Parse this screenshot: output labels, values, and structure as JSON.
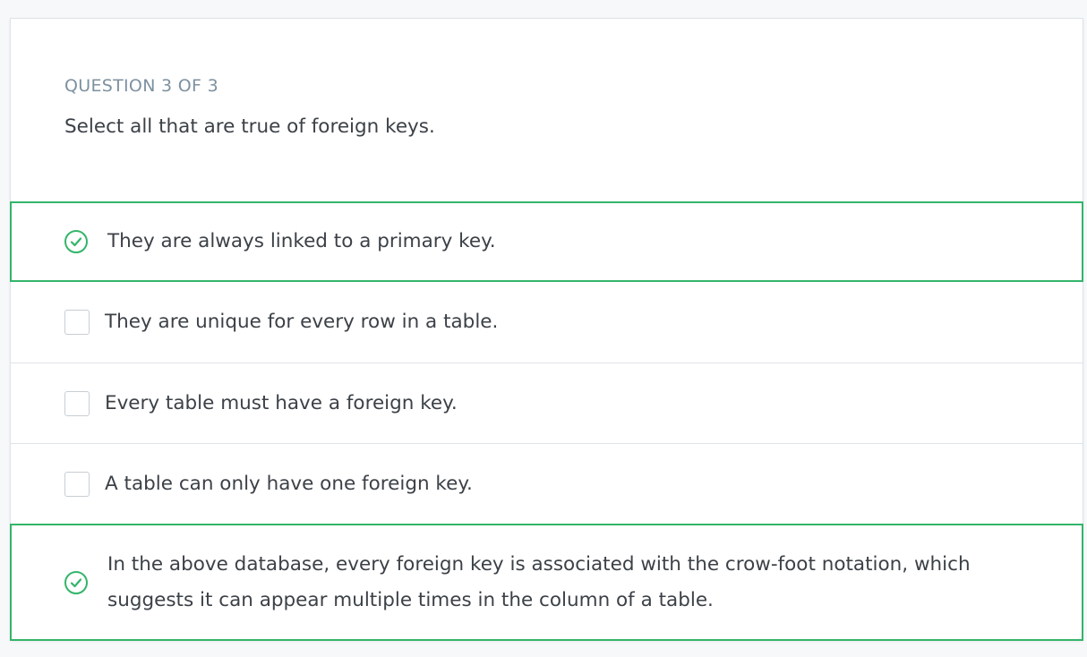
{
  "question": {
    "counter": "QUESTION 3 OF 3",
    "prompt": "Select all that are true of foreign keys."
  },
  "options": [
    {
      "label": "They are always linked to a primary key.",
      "state": "correct"
    },
    {
      "label": "They are unique for every row in a table.",
      "state": "unchecked"
    },
    {
      "label": "Every table must have a foreign key.",
      "state": "unchecked"
    },
    {
      "label": "A table can only have one foreign key.",
      "state": "unchecked"
    },
    {
      "label": "In the above database, every foreign key is associated with the crow-foot notation, which suggests it can appear multiple times in the column of a table.",
      "state": "correct"
    }
  ],
  "colors": {
    "correct": "#33b56a",
    "counter": "#7d91a0",
    "text": "#3c4147",
    "border": "#dde3e8"
  },
  "icons": {
    "correct": "check-circle-icon",
    "unchecked": "checkbox-empty"
  }
}
